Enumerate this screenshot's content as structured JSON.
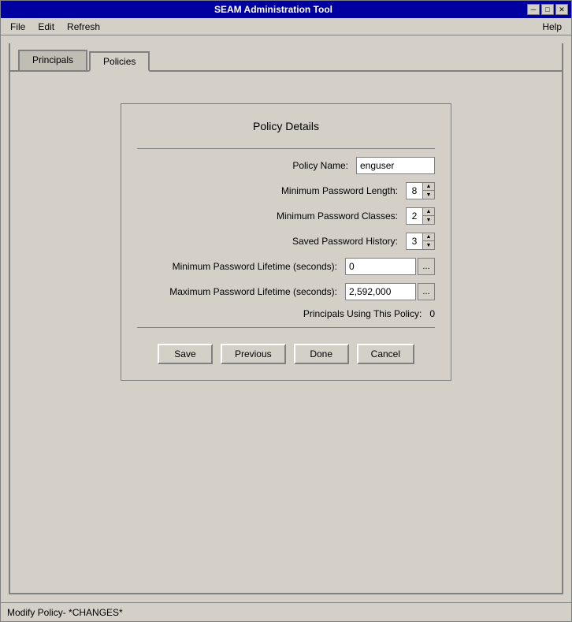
{
  "window": {
    "title": "SEAM Administration Tool",
    "icon": "🔒"
  },
  "title_bar_controls": {
    "minimize": "─",
    "maximize": "□",
    "close": "✕"
  },
  "menu": {
    "items": [
      "File",
      "Edit",
      "Refresh"
    ],
    "help": "Help"
  },
  "tabs": [
    {
      "label": "Principals",
      "active": false
    },
    {
      "label": "Policies",
      "active": true
    }
  ],
  "policy_details": {
    "title": "Policy Details",
    "fields": {
      "policy_name_label": "Policy Name:",
      "policy_name_value": "enguser",
      "min_password_length_label": "Minimum Password Length:",
      "min_password_length_value": "8",
      "min_password_classes_label": "Minimum Password Classes:",
      "min_password_classes_value": "2",
      "saved_password_history_label": "Saved Password History:",
      "saved_password_history_value": "3",
      "min_password_lifetime_label": "Minimum Password Lifetime (seconds):",
      "min_password_lifetime_value": "0",
      "max_password_lifetime_label": "Maximum Password Lifetime (seconds):",
      "max_password_lifetime_value": "2,592,000",
      "principals_using_label": "Principals Using This Policy:",
      "principals_using_value": "0"
    },
    "buttons": {
      "save": "Save",
      "previous": "Previous",
      "done": "Done",
      "cancel": "Cancel"
    },
    "ellipsis": "..."
  },
  "status_bar": {
    "text": "Modify Policy- *CHANGES*"
  }
}
